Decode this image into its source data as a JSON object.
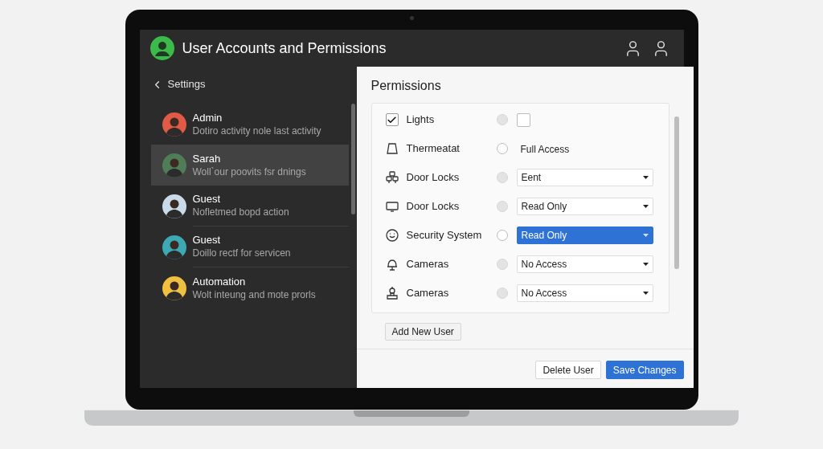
{
  "app": {
    "title": "User Accounts and Permissions"
  },
  "sidebar": {
    "back": "Settings",
    "users": [
      {
        "name": "Admin",
        "detail": "Dotiro activity nole last activity",
        "selected": false,
        "color": "#e05a45"
      },
      {
        "name": "Sarah",
        "detail": "Woll`our poovits fsr dnings",
        "selected": true,
        "color": "#4f7d58"
      },
      {
        "name": "Guest",
        "detail": "Nofletmed bopd action",
        "selected": false,
        "color": "#c9dbe8"
      },
      {
        "name": "Guest",
        "detail": "Doillo rectf for servicen",
        "selected": false,
        "color": "#3ca9b5"
      },
      {
        "name": "Automation",
        "detail": "Wolt inteung and mote prorls",
        "selected": false,
        "color": "#f0c040"
      }
    ]
  },
  "permissions": {
    "title": "Permissions",
    "rows": [
      {
        "kind": "checkbox",
        "checked": true,
        "label": "Lights",
        "radio_disabled": true,
        "control": {
          "kind": "checkbox",
          "checked": false
        }
      },
      {
        "kind": "device",
        "label": "Thermeatat",
        "radio_disabled": false,
        "control": {
          "kind": "text",
          "value": "Full Access"
        }
      },
      {
        "kind": "device",
        "label": "Door Locks",
        "radio_disabled": true,
        "control": {
          "kind": "select",
          "value": "Eent",
          "selected": false
        }
      },
      {
        "kind": "device",
        "label": "Door Locks",
        "radio_disabled": true,
        "control": {
          "kind": "select",
          "value": "Read Only",
          "selected": false
        }
      },
      {
        "kind": "device",
        "label": "Security System",
        "radio_disabled": false,
        "control": {
          "kind": "select",
          "value": "Read Only",
          "selected": true
        }
      },
      {
        "kind": "device",
        "label": "Cameras",
        "radio_disabled": true,
        "control": {
          "kind": "select",
          "value": "No Access",
          "selected": false
        }
      },
      {
        "kind": "device",
        "label": "Cameras",
        "radio_disabled": true,
        "control": {
          "kind": "select",
          "value": "No Access",
          "selected": false
        }
      }
    ],
    "add_button": "Add New User"
  },
  "footer": {
    "buttons": [
      {
        "label": "Delete User",
        "kind": "secondary"
      },
      {
        "label": "Save Changes",
        "kind": "primary"
      }
    ]
  }
}
